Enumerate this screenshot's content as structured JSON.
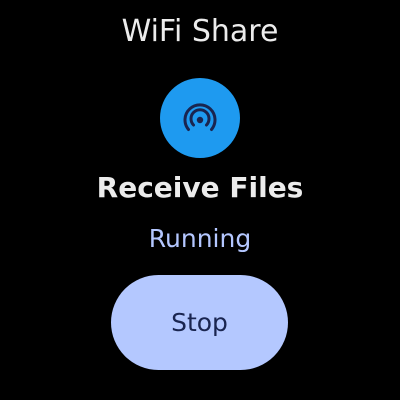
{
  "app": {
    "title": "WiFi Share"
  },
  "status": {
    "icon": "wireless-signal-icon",
    "icon_color": "#1E9AF0",
    "feature": "Receive Files",
    "state": "Running",
    "state_color": "#B4C7FF"
  },
  "actions": {
    "stop_label": "Stop",
    "stop_color": "#B4C8FF"
  }
}
